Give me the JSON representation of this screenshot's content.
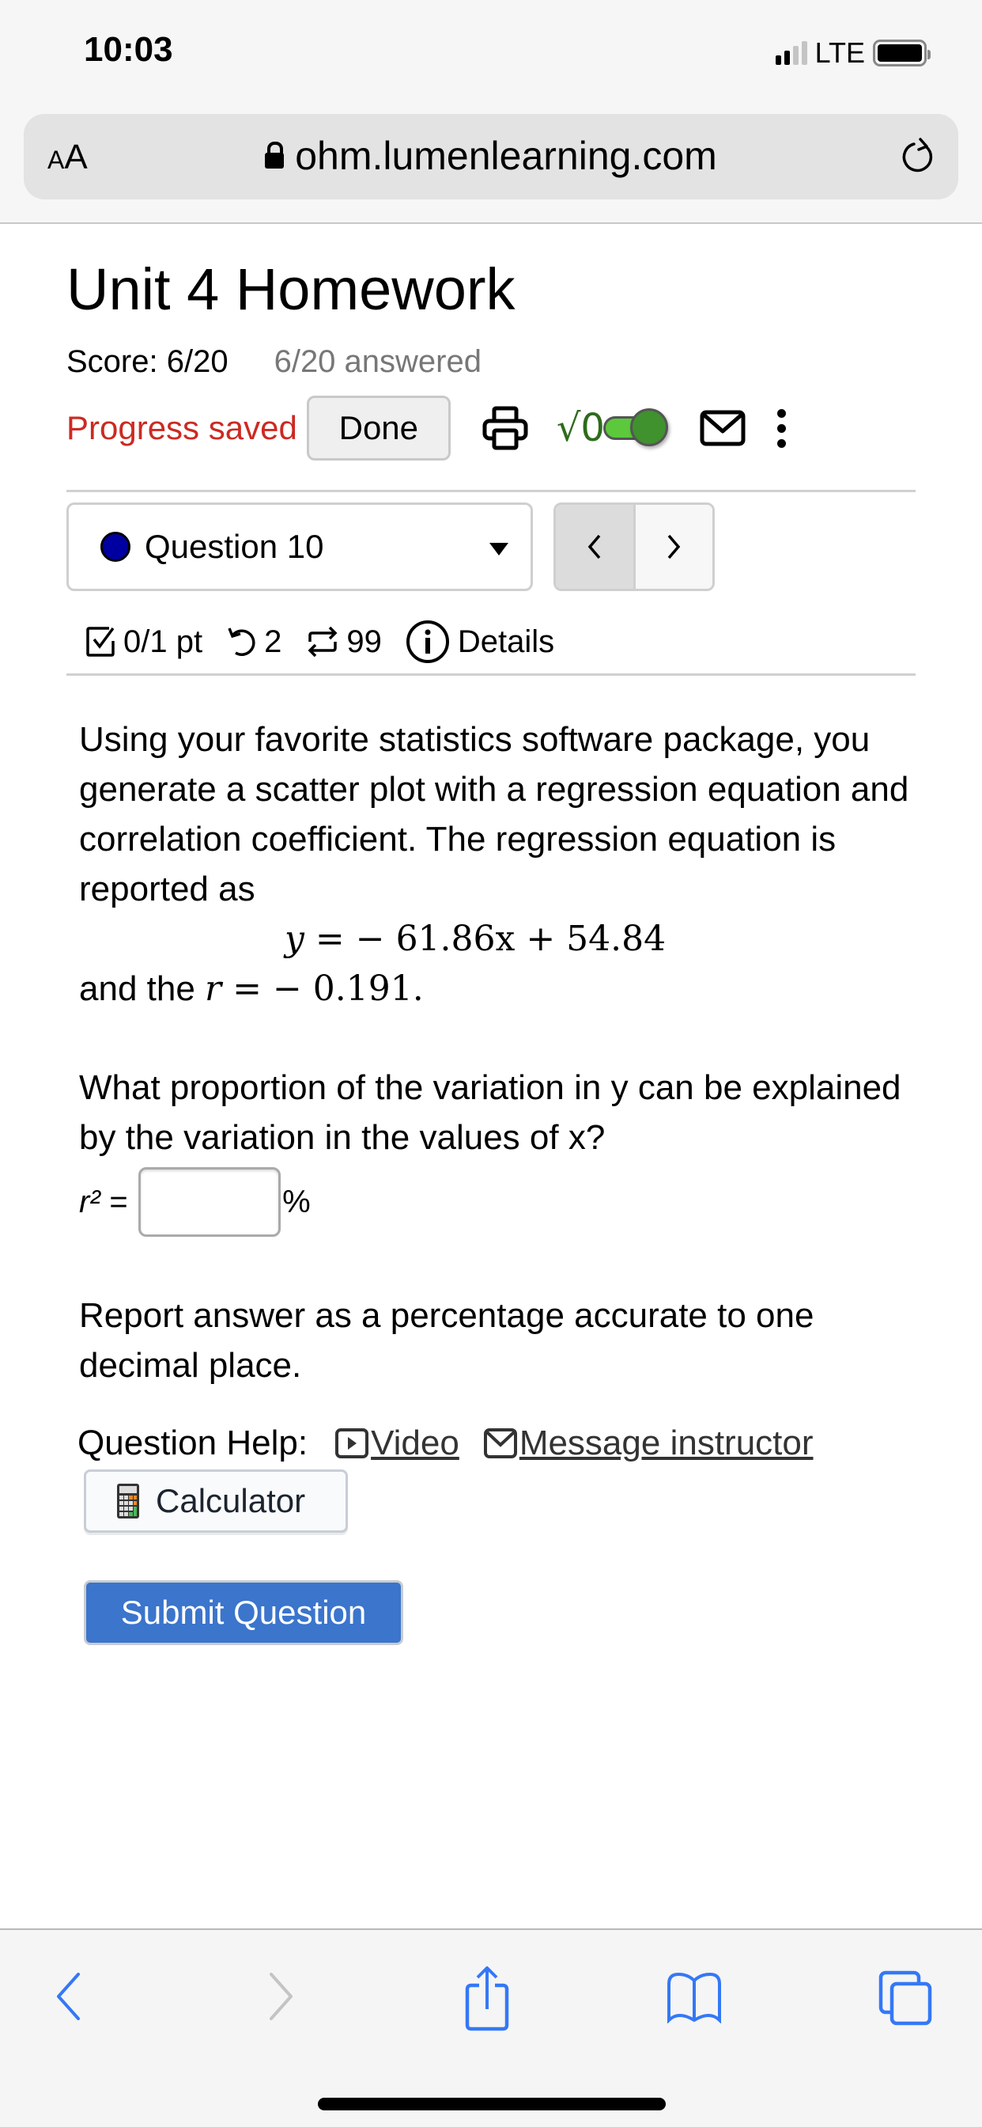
{
  "status_bar": {
    "time": "10:03",
    "network": "LTE",
    "signal_bars_active": 2,
    "signal_bars_total": 4,
    "battery_level": 1.0
  },
  "browser": {
    "text_size_label": "AA",
    "url": "ohm.lumenlearning.com",
    "lock_icon": "lock-icon",
    "reload_icon": "reload-icon"
  },
  "page": {
    "title": "Unit 4 Homework",
    "score": "Score: 6/20",
    "answered": "6/20 answered",
    "progress_status": "Progress saved",
    "done_label": "Done",
    "math_toggle_label": "√0",
    "math_toggle_on": true,
    "colors": {
      "progress_saved": "#cc2a22",
      "math_green": "#2e6b1c",
      "toggle_track": "#5cc93c",
      "toggle_knob": "#3f922d",
      "question_dot": "#0000a0",
      "submit_blue": "#3b75cc",
      "safari_blue": "#3478f6"
    }
  },
  "question_nav": {
    "selected_question": "Question 10",
    "prev_label": "‹",
    "next_label": "›"
  },
  "question_meta": {
    "points": "0/1 pt",
    "retries": "2",
    "attempts": "99",
    "details_label": "Details"
  },
  "question": {
    "intro": "Using your favorite statistics software package, you generate a scatter plot with a regression equation and correlation coefficient. The regression equation is reported as",
    "equation_lhs": "y",
    "equation_rhs": "= − 61.86x + 54.84",
    "equation_slope": "−61.86",
    "equation_intercept": "54.84",
    "r_prefix": "and the",
    "r_symbol": "r",
    "r_value": "= − 0.191.",
    "prompt": "What proportion of the variation in y can be explained by the variation in the values of x?",
    "answer_label": "r² =",
    "answer_value": "",
    "answer_unit": "%",
    "instructions": "Report answer as a percentage accurate to one decimal place."
  },
  "help": {
    "label": "Question Help:",
    "video_label": "Video",
    "message_label": "Message instructor",
    "calculator_label": "Calculator",
    "submit_label": "Submit Question"
  },
  "toolbar": {
    "items": [
      "back",
      "forward",
      "share",
      "bookmarks",
      "tabs"
    ]
  }
}
